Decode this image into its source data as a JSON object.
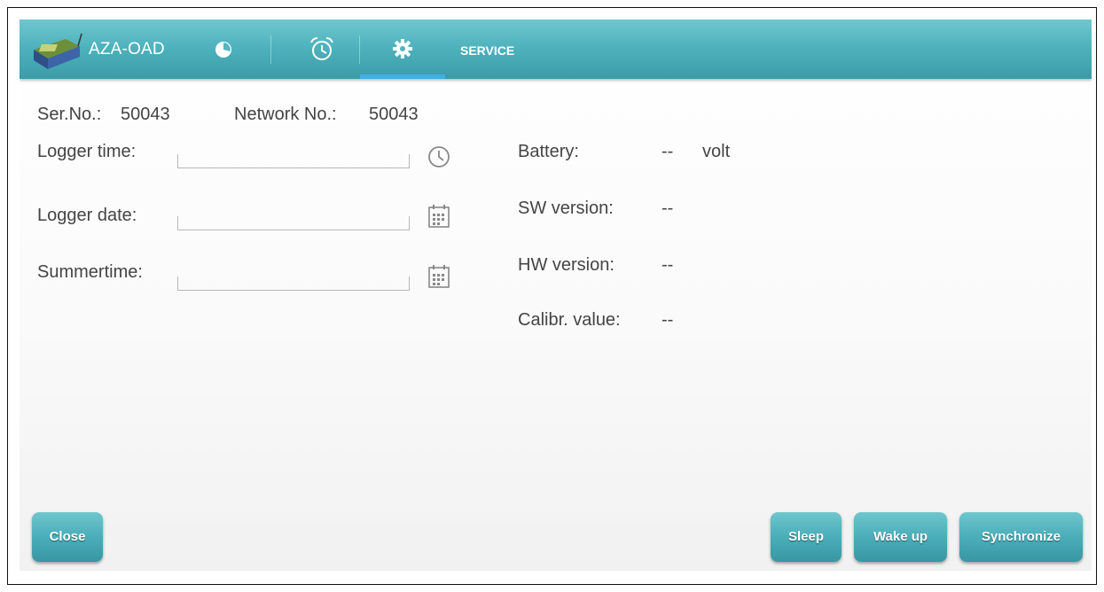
{
  "app": {
    "title": "AZA-OAD"
  },
  "tabs": [
    {
      "name": "overview",
      "icon": "pie-chart-icon"
    },
    {
      "name": "alarm",
      "icon": "alarm-clock-icon"
    },
    {
      "name": "service",
      "icon": "gear-icon",
      "label": "SERVICE",
      "selected": true
    }
  ],
  "info": {
    "serial_label": "Ser.No.:",
    "serial_value": "50043",
    "network_label": "Network No.:",
    "network_value": "50043"
  },
  "form": {
    "logger_time": {
      "label": "Logger time:",
      "value": "",
      "icon": "clock-icon"
    },
    "logger_date": {
      "label": "Logger date:",
      "value": "",
      "icon": "calendar-icon"
    },
    "summertime": {
      "label": "Summertime:",
      "value": "",
      "icon": "calendar-icon"
    }
  },
  "status": {
    "battery_label": "Battery:",
    "battery_value": "--",
    "battery_unit": "volt",
    "sw_label": "SW version:",
    "sw_value": "--",
    "hw_label": "HW version:",
    "hw_value": "--",
    "calibr_label": "Calibr. value:",
    "calibr_value": "--"
  },
  "buttons": {
    "close": "Close",
    "sleep": "Sleep",
    "wake_up": "Wake up",
    "synchronize": "Synchronize"
  },
  "colors": {
    "actionbar": "#4fb3bd",
    "tab_indicator": "#3db0e8",
    "button": "#4aaeb9"
  }
}
